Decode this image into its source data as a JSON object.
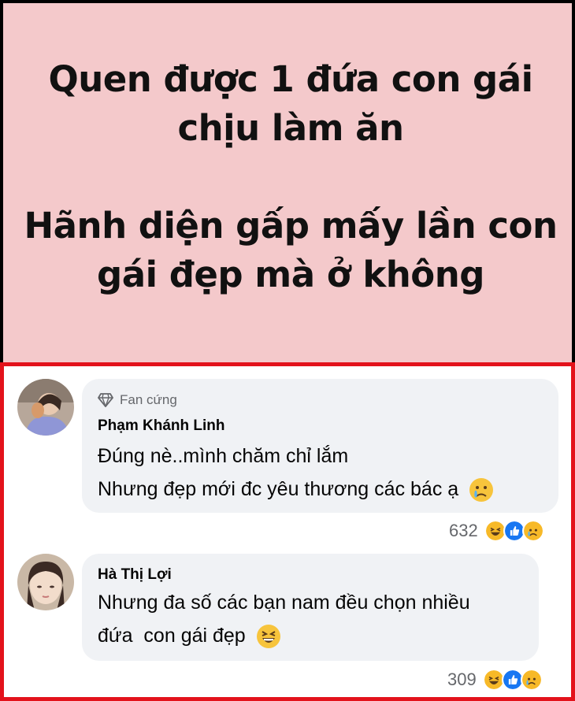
{
  "post": {
    "headline_lines": [
      "Quen được 1 đứa con gái",
      "chịu làm ăn",
      "Hãnh diện gấp mấy lần con",
      "gái đẹp mà ở không"
    ],
    "background_color": "#f4c9cb"
  },
  "comments": [
    {
      "badge": "Fan cứng",
      "badge_icon": "diamond-icon",
      "author": "Phạm Khánh Linh",
      "lines": [
        "Đúng nè..mình chăm chỉ lắm",
        "Nhưng đẹp mới đc yêu thương các bác ạ"
      ],
      "inline_emoji": "sad-tear-emoji",
      "reaction_count": "632",
      "reactions": [
        "haha-icon",
        "like-icon",
        "sad-icon"
      ]
    },
    {
      "author": "Hà Thị Lợi",
      "lines": [
        "Nhưng đa số các bạn nam đều chọn nhiều",
        "đứa  con gái đẹp"
      ],
      "inline_emoji": "grin-squint-emoji",
      "reaction_count": "309",
      "reactions": [
        "haha-icon",
        "like-icon",
        "sad-icon"
      ]
    }
  ],
  "colors": {
    "highlight_border": "#e3121b",
    "bubble": "#f0f2f5",
    "like_blue": "#1877f2",
    "reaction_yellow": "#f7b928"
  }
}
